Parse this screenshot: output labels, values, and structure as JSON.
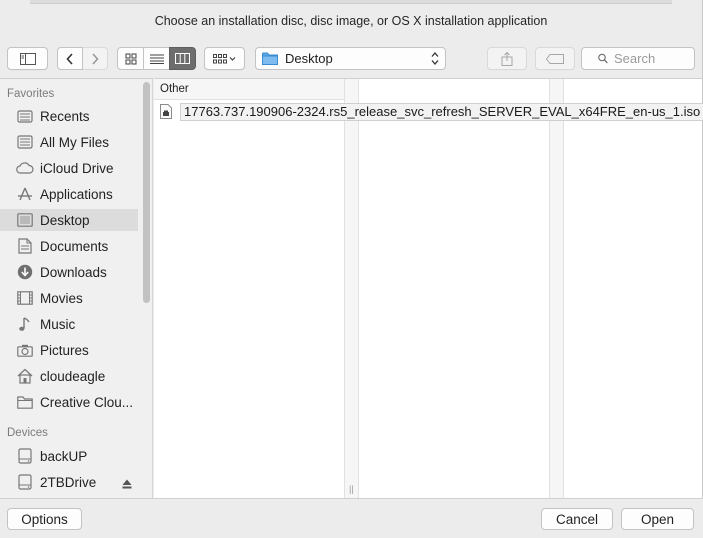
{
  "dialog": {
    "title": "Choose an installation disc, disc image, or OS X installation application"
  },
  "toolbar": {
    "location": "Desktop",
    "search_placeholder": "Search"
  },
  "sidebar": {
    "favorites_header": "Favorites",
    "favorites": [
      {
        "label": "Recents",
        "icon": "recents-icon"
      },
      {
        "label": "All My Files",
        "icon": "all-files-icon"
      },
      {
        "label": "iCloud Drive",
        "icon": "cloud-icon"
      },
      {
        "label": "Applications",
        "icon": "applications-icon"
      },
      {
        "label": "Desktop",
        "icon": "desktop-icon",
        "selected": true
      },
      {
        "label": "Documents",
        "icon": "documents-icon"
      },
      {
        "label": "Downloads",
        "icon": "downloads-icon"
      },
      {
        "label": "Movies",
        "icon": "movies-icon"
      },
      {
        "label": "Music",
        "icon": "music-icon"
      },
      {
        "label": "Pictures",
        "icon": "camera-icon"
      },
      {
        "label": "cloudeagle",
        "icon": "home-icon"
      },
      {
        "label": "Creative Clou...",
        "icon": "folder-icon"
      }
    ],
    "devices_header": "Devices",
    "devices": [
      {
        "label": "backUP",
        "icon": "drive-icon"
      },
      {
        "label": "2TBDrive",
        "icon": "drive-icon",
        "ejectable": true
      }
    ]
  },
  "browser": {
    "column_header": "Other",
    "file": "17763.737.190906-2324.rs5_release_svc_refresh_SERVER_EVAL_x64FRE_en-us_1.iso"
  },
  "buttons": {
    "options": "Options",
    "cancel": "Cancel",
    "open": "Open"
  }
}
